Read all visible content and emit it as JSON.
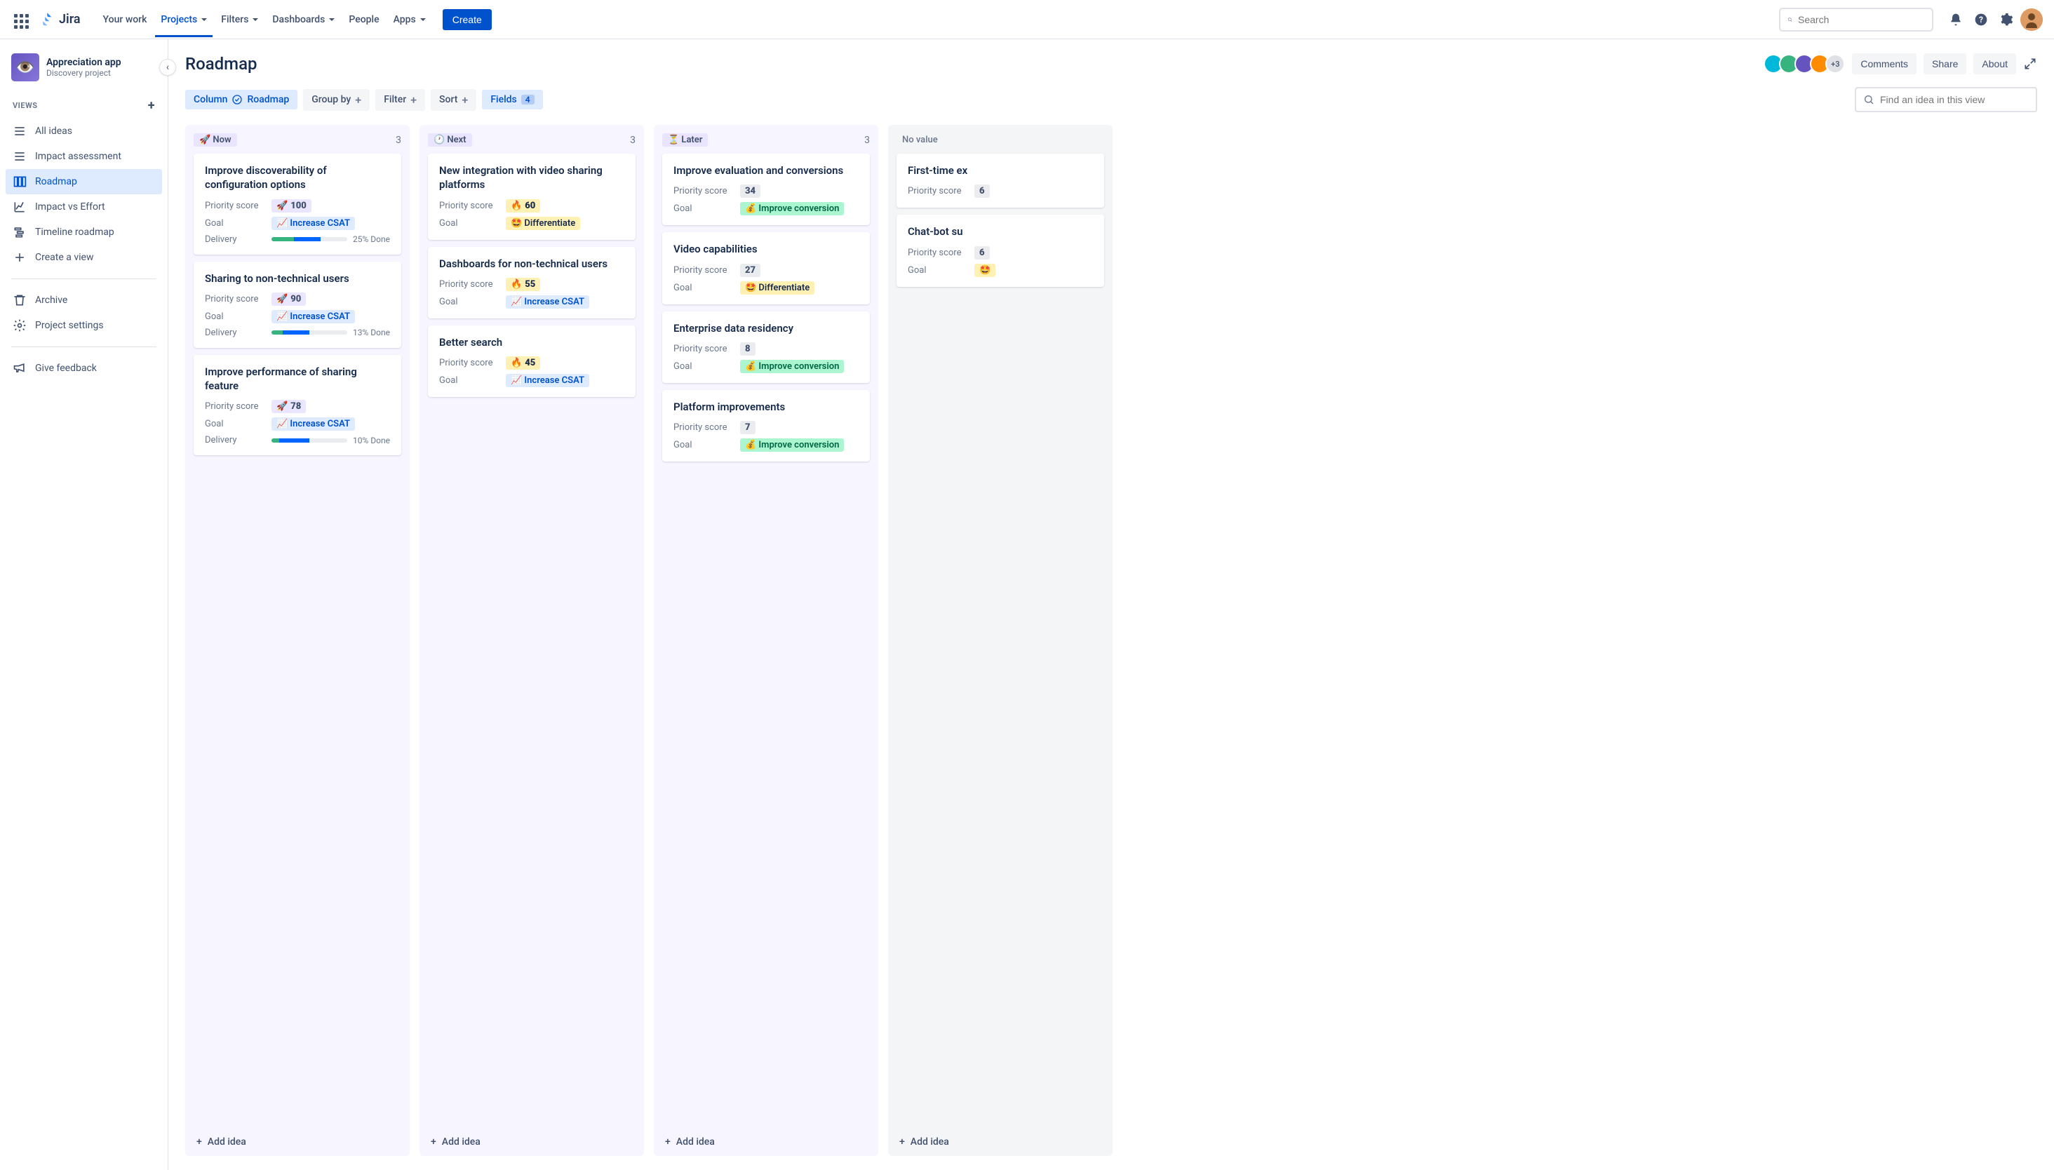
{
  "nav": {
    "product": "Jira",
    "links": [
      "Your work",
      "Projects",
      "Filters",
      "Dashboards",
      "People",
      "Apps"
    ],
    "active_index": 1,
    "create_label": "Create",
    "search_placeholder": "Search"
  },
  "sidebar": {
    "project_name": "Appreciation app",
    "project_type": "Discovery project",
    "views_heading": "VIEWS",
    "items": [
      {
        "icon": "list",
        "label": "All ideas"
      },
      {
        "icon": "list",
        "label": "Impact assessment"
      },
      {
        "icon": "board",
        "label": "Roadmap"
      },
      {
        "icon": "chart",
        "label": "Impact vs Effort"
      },
      {
        "icon": "timeline",
        "label": "Timeline roadmap"
      },
      {
        "icon": "plus",
        "label": "Create a view"
      }
    ],
    "active_index": 2,
    "archive_label": "Archive",
    "settings_label": "Project settings",
    "feedback_label": "Give feedback"
  },
  "header": {
    "title": "Roadmap",
    "avatar_overflow": "+3",
    "comments_label": "Comments",
    "share_label": "Share",
    "about_label": "About"
  },
  "toolbar": {
    "column": {
      "label": "Column",
      "value": "Roadmap"
    },
    "group_label": "Group by",
    "filter_label": "Filter",
    "sort_label": "Sort",
    "fields": {
      "label": "Fields",
      "count": "4"
    },
    "find_placeholder": "Find an idea in this view"
  },
  "field_labels": {
    "priority": "Priority score",
    "goal": "Goal",
    "delivery": "Delivery"
  },
  "done_suffix": "% Done",
  "add_idea_label": "Add idea",
  "columns": [
    {
      "emoji": "🚀",
      "name": "Now",
      "count": "3",
      "plain": false,
      "cards": [
        {
          "title": "Improve discoverability of configuration options",
          "score_emoji": "🚀",
          "score": "100",
          "score_style": "pill-score",
          "goal_emoji": "📈",
          "goal": "Increase CSAT",
          "goal_style": "pill-goal-csat",
          "delivery": {
            "g": 30,
            "b": 35,
            "pct": "25"
          }
        },
        {
          "title": "Sharing to non-technical users",
          "score_emoji": "🚀",
          "score": "90",
          "score_style": "pill-score",
          "goal_emoji": "📈",
          "goal": "Increase CSAT",
          "goal_style": "pill-goal-csat",
          "delivery": {
            "g": 15,
            "b": 35,
            "pct": "13"
          }
        },
        {
          "title": "Improve performance of sharing feature",
          "score_emoji": "🚀",
          "score": "78",
          "score_style": "pill-score",
          "goal_emoji": "📈",
          "goal": "Increase CSAT",
          "goal_style": "pill-goal-csat",
          "delivery": {
            "g": 10,
            "b": 40,
            "pct": "10"
          }
        }
      ]
    },
    {
      "emoji": "🕐",
      "name": "Next",
      "count": "3",
      "plain": false,
      "cards": [
        {
          "title": "New integration with video sharing platforms",
          "score_emoji": "🔥",
          "score": "60",
          "score_style": "pill-score hot",
          "goal_emoji": "🤩",
          "goal": "Differentiate",
          "goal_style": "pill-goal-diff"
        },
        {
          "title": "Dashboards for non-technical users",
          "score_emoji": "🔥",
          "score": "55",
          "score_style": "pill-score hot",
          "goal_emoji": "📈",
          "goal": "Increase CSAT",
          "goal_style": "pill-goal-csat"
        },
        {
          "title": "Better search",
          "score_emoji": "🔥",
          "score": "45",
          "score_style": "pill-score hot",
          "goal_emoji": "📈",
          "goal": "Increase CSAT",
          "goal_style": "pill-goal-csat"
        }
      ]
    },
    {
      "emoji": "⏳",
      "name": "Later",
      "count": "3",
      "plain": false,
      "cards": [
        {
          "title": "Improve evaluation and conversions",
          "score": "34",
          "score_style": "pill-score gray",
          "goal_emoji": "💰",
          "goal": "Improve conversion",
          "goal_style": "pill-goal-conv"
        },
        {
          "title": "Video capabilities",
          "score": "27",
          "score_style": "pill-score gray",
          "goal_emoji": "🤩",
          "goal": "Differentiate",
          "goal_style": "pill-goal-diff"
        },
        {
          "title": "Enterprise data residency",
          "score": "8",
          "score_style": "pill-score gray",
          "goal_emoji": "💰",
          "goal": "Improve conversion",
          "goal_style": "pill-goal-conv"
        },
        {
          "title": "Platform improvements",
          "score": "7",
          "score_style": "pill-score gray",
          "goal_emoji": "💰",
          "goal": "Improve conversion",
          "goal_style": "pill-goal-conv"
        }
      ]
    },
    {
      "emoji": "",
      "name": "No value",
      "count": "",
      "plain": true,
      "cards": [
        {
          "title": "First-time ex",
          "score": "6",
          "score_style": "pill-score gray"
        },
        {
          "title": "Chat-bot su",
          "score": "6",
          "score_style": "pill-score gray",
          "goal_emoji": "🤩",
          "goal": "",
          "goal_style": "pill-goal-diff"
        }
      ]
    }
  ]
}
